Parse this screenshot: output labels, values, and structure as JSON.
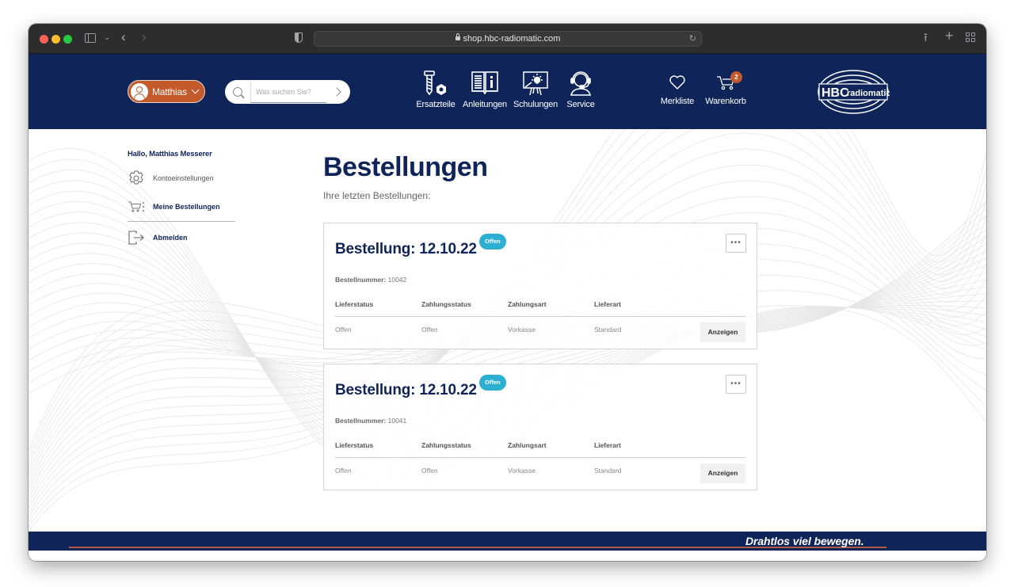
{
  "browser": {
    "url": "shop.hbc-radiomatic.com",
    "icons": [
      "sidebar-icon",
      "chevron-down-icon",
      "back-icon",
      "forward-icon",
      "privacy-shield-icon",
      "lock-icon",
      "reload-icon",
      "share-icon",
      "new-tab-icon",
      "tab-overview-icon"
    ]
  },
  "header": {
    "user": {
      "name": "Matthias",
      "icon": "user-icon"
    },
    "search": {
      "placeholder": "Was suchen Sie?",
      "value": ""
    },
    "nav": [
      {
        "label": "Ersatzteile",
        "icon": "screw-nut-icon"
      },
      {
        "label": "Anleitungen",
        "icon": "manual-book-icon"
      },
      {
        "label": "Schulungen",
        "icon": "training-presentation-icon"
      },
      {
        "label": "Service",
        "icon": "headset-support-icon"
      }
    ],
    "wishlist": {
      "label": "Merkliste",
      "icon": "heart-icon"
    },
    "cart": {
      "label": "Warenkorb",
      "icon": "cart-icon",
      "count": "2"
    },
    "logo": {
      "text_primary": "HBC",
      "text_secondary": "radiomatic"
    },
    "colors": {
      "brand_navy": "#0f2559",
      "accent_orange": "#c4592a",
      "status_cyan": "#2bb0d3"
    }
  },
  "sidebar": {
    "greeting": "Hallo, Matthias Messerer",
    "items": [
      {
        "label": "Kontoeinstellungen",
        "icon": "gear-icon",
        "active": false
      },
      {
        "label": "Meine Bestellungen",
        "icon": "cart-list-icon",
        "active": true
      },
      {
        "label": "Abmelden",
        "icon": "logout-icon",
        "active": false
      }
    ]
  },
  "main": {
    "title": "Bestellungen",
    "subtitle": "Ihre letzten Bestellungen:",
    "columns": [
      "Lieferstatus",
      "Zahlungsstatus",
      "Zahlungsart",
      "Lieferart"
    ],
    "order_number_label": "Bestellnummer:",
    "show_label": "Anzeigen",
    "more_label": "•••",
    "orders": [
      {
        "title": "Bestellung: 12.10.22",
        "status": "Offen",
        "number": "10042",
        "values": [
          "Offen",
          "Offen",
          "Vorkasse",
          "Standard"
        ]
      },
      {
        "title": "Bestellung: 12.10.22",
        "status": "Offen",
        "number": "10041",
        "values": [
          "Offen",
          "Offen",
          "Vorkasse",
          "Standard"
        ]
      }
    ]
  },
  "footer": {
    "slogan": "Drahtlos viel bewegen."
  }
}
